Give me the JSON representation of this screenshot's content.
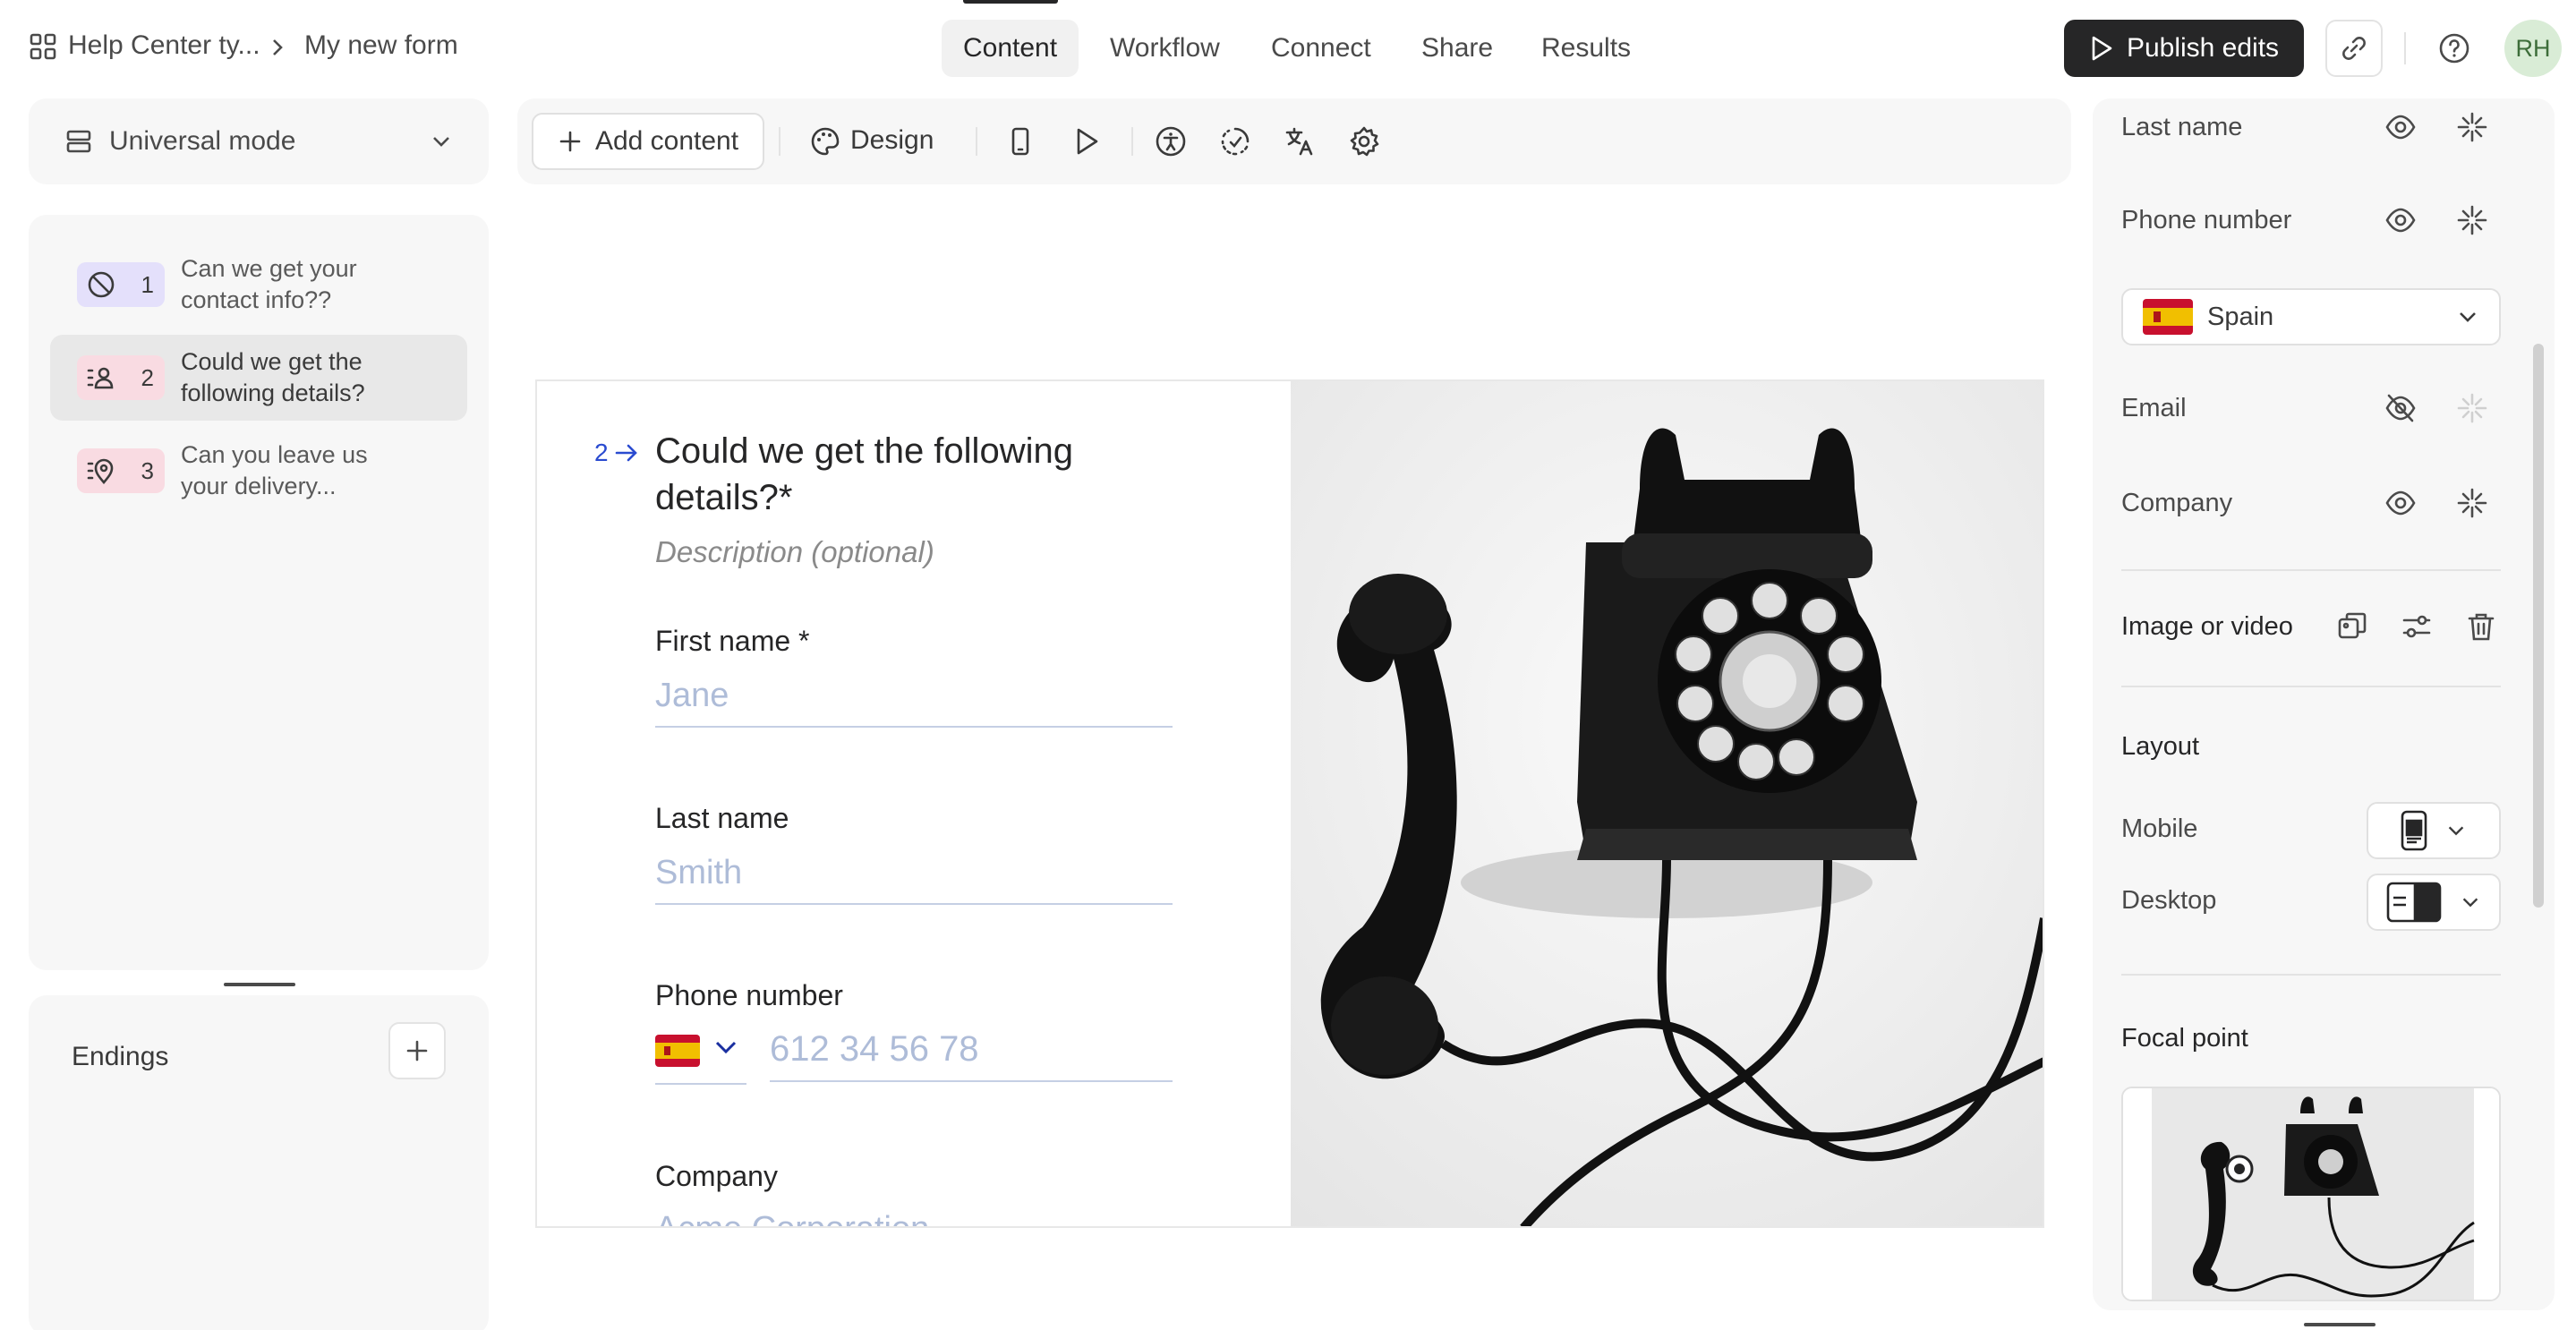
{
  "breadcrumb": {
    "workspace": "Help Center ty...",
    "form": "My new form"
  },
  "nav_tabs": {
    "content": "Content",
    "workflow": "Workflow",
    "connect": "Connect",
    "share": "Share",
    "results": "Results"
  },
  "header": {
    "publish_label": "Publish edits",
    "avatar_initials": "RH"
  },
  "mode_selector": {
    "label": "Universal mode"
  },
  "toolbar": {
    "add_content": "Add content",
    "design": "Design"
  },
  "questions": [
    {
      "number": "1",
      "title": "Can we get your contact info??",
      "icon": "block-icon",
      "badge_color": "#e4e0fb"
    },
    {
      "number": "2",
      "title": "Could we get the following details?",
      "icon": "contact-list-icon",
      "badge_color": "#f9dbe2"
    },
    {
      "number": "3",
      "title": "Can you leave us your delivery...",
      "icon": "location-list-icon",
      "badge_color": "#f9dbe2"
    }
  ],
  "endings": {
    "label": "Endings"
  },
  "form_preview": {
    "question_number": "2",
    "title": "Could we get the following details?*",
    "description_placeholder": "Description (optional)",
    "fields": [
      {
        "label": "First name *",
        "placeholder": "Jane"
      },
      {
        "label": "Last name",
        "placeholder": "Smith"
      },
      {
        "label": "Phone number",
        "placeholder": "612 34 56 78"
      },
      {
        "label": "Company",
        "placeholder": "Acme Corporation"
      }
    ]
  },
  "settings_panel": {
    "field_rows": [
      {
        "label": "Last name",
        "visible": true
      },
      {
        "label": "Phone number",
        "visible": true
      },
      {
        "label": "Email",
        "visible": false
      },
      {
        "label": "Company",
        "visible": true
      }
    ],
    "country_select": "Spain",
    "media_label": "Image or video",
    "layout_heading": "Layout",
    "mobile_label": "Mobile",
    "desktop_label": "Desktop",
    "focal_point_heading": "Focal point"
  },
  "colors": {
    "primary_dark": "#262627",
    "accent_blue": "#2a4bd0",
    "placeholder": "#aebcd8"
  }
}
